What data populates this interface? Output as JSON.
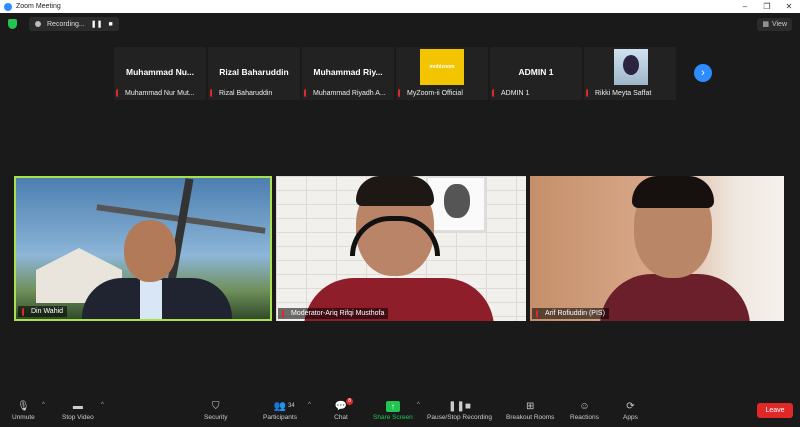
{
  "window": {
    "title": "Zoom Meeting",
    "controls": [
      "–",
      "❐",
      "✕"
    ]
  },
  "topbar": {
    "recording_label": "Recording...",
    "pause_glyph": "❚❚",
    "stop_glyph": "■",
    "view_label": "View"
  },
  "thumbnails": [
    {
      "big": "Muhammad  Nu...",
      "name": "Muhammad Nur Mut..."
    },
    {
      "big": "Rizal Baharuddin",
      "name": "Rizal Baharuddin"
    },
    {
      "big": "Muhammad  Riy...",
      "name": "Muhammad Riyadh A..."
    },
    {
      "big": "",
      "logo_text": "mobizoom",
      "name": "MyZoom-ii Official"
    },
    {
      "big": "ADMIN 1",
      "name": "ADMIN 1"
    },
    {
      "big": "",
      "name": "Rikki Meyta Saffat"
    }
  ],
  "next_glyph": "›",
  "videos": [
    {
      "name": "Din Wahid"
    },
    {
      "name": "Moderator-Ariq Rifqi Musthofa"
    },
    {
      "name": "Arif Rofiuddin (PIS)"
    }
  ],
  "toolbar": {
    "unmute": "Unmute",
    "stop_video": "Stop Video",
    "security": "Security",
    "participants": "Participants",
    "participants_count": "34",
    "chat": "Chat",
    "chat_badge": "8",
    "share_screen": "Share Screen",
    "pause_recording": "Pause/Stop Recording",
    "breakout_rooms": "Breakout Rooms",
    "reactions": "Reactions",
    "apps": "Apps",
    "leave": "Leave",
    "caret": "^"
  },
  "colors": {
    "active_speaker": "#a9e14c",
    "share": "#23c552",
    "leave": "#e02828",
    "accent": "#2d8cff"
  }
}
